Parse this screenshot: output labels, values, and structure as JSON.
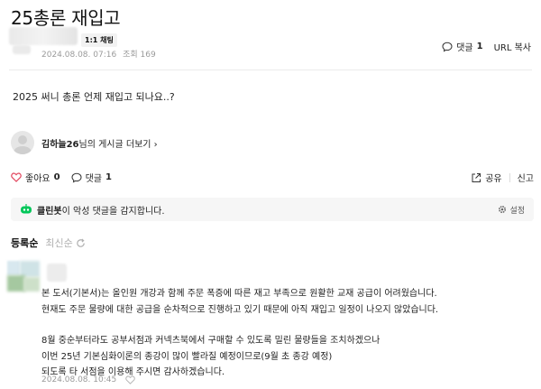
{
  "post": {
    "title": "25총론 재입고",
    "chat_badge": "1:1 채팅",
    "date": "2024.08.08. 07:16",
    "views": "조회 169",
    "body": "2025 써니 총론 언제 재입고 되나요..?"
  },
  "top_actions": {
    "comment_label": "댓글",
    "comment_count": "1",
    "url_copy": "URL 복사"
  },
  "profile": {
    "nickname": "김하늘26",
    "suffix": "님의 게시글 더보기 ›"
  },
  "actions": {
    "like_label": "좋아요",
    "like_count": "0",
    "comment_label": "댓글",
    "comment_count": "1",
    "share": "공유",
    "report": "신고"
  },
  "cleanbot": {
    "name": "클린봇",
    "message": "이 악성 댓글을 감지합니다.",
    "settings": "설정"
  },
  "sort": {
    "registered": "등록순",
    "latest": "최신순"
  },
  "comment": {
    "lines1": [
      "본 도서(기본서)는 올인원 개강과 함께 주문 폭증에 따른 재고 부족으로 원활한 교재 공급이 어려웠습니다.",
      "현재도 주문 물량에 대한 공급을 순차적으로 진행하고 있기 때문에 아직 재입고 일정이 나오지 않았습니다."
    ],
    "lines2": [
      "8월 중순부터라도 공부서점과 커넥츠북에서 구매할 수 있도록 밀린 물량들을 조치하겠으나",
      "이번 25년 기본심화이론의 종강이 많이 빨라질 예정이므로(9월 초 종강 예정)",
      "되도록 타 서점을 이용해 주시면 감사하겠습니다."
    ],
    "date": "2024.08.08. 10:45"
  },
  "colors": {
    "like_heart": "#e2445c",
    "cleanbot_green": "#03c75a",
    "muted": "#9a9a9a"
  }
}
